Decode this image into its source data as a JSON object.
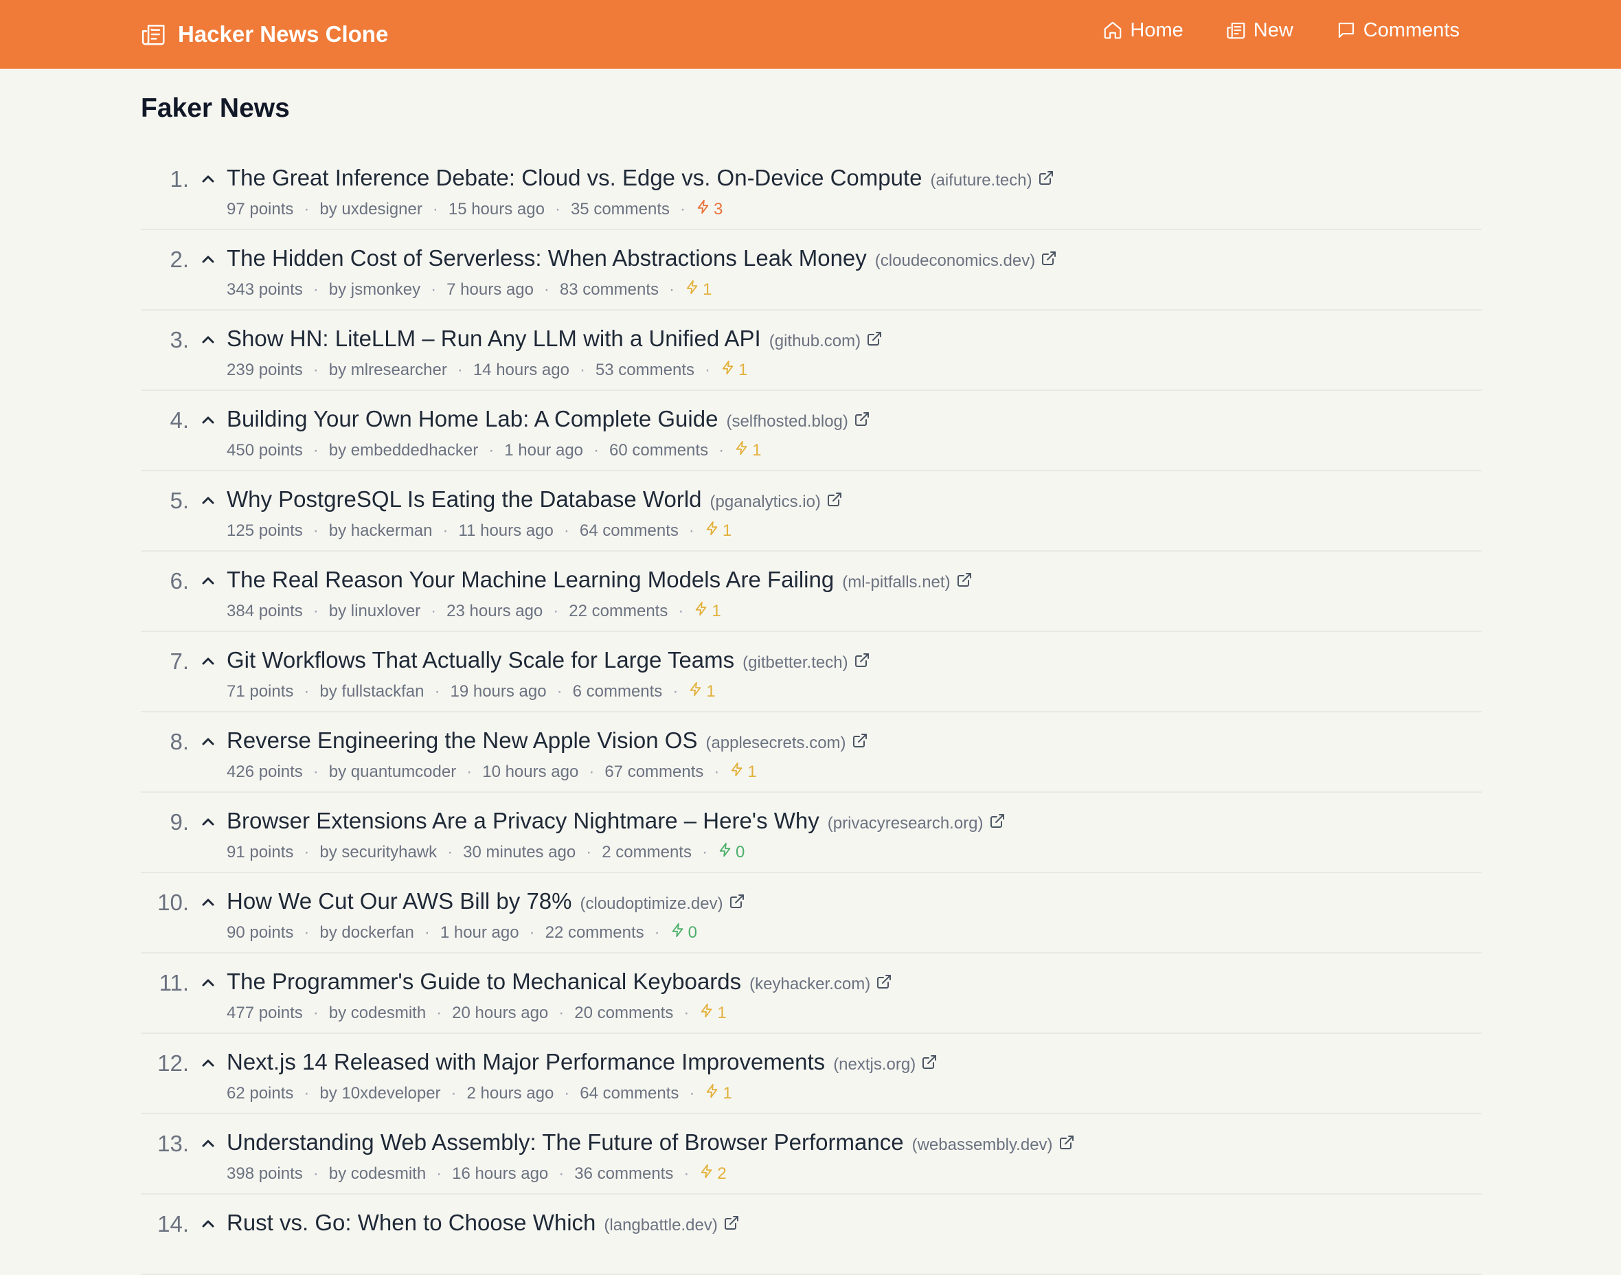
{
  "header": {
    "app_name": "Hacker News Clone",
    "nav": [
      {
        "label": "Home",
        "icon": "home-icon"
      },
      {
        "label": "New",
        "icon": "newspaper-icon"
      },
      {
        "label": "Comments",
        "icon": "comment-icon"
      }
    ],
    "logo_icon": "newspaper-icon",
    "accent_color": "#f07b38"
  },
  "main": {
    "title": "Faker News",
    "stories": [
      {
        "rank": "1.",
        "title": "The Great Inference Debate: Cloud vs. Edge vs. On-Device Compute",
        "domain": "(aifuture.tech)",
        "points": "97 points",
        "author": "by uxdesigner",
        "time": "15 hours ago",
        "comments": "35 comments",
        "boost": "3",
        "boost_color": "#e8743b"
      },
      {
        "rank": "2.",
        "title": "The Hidden Cost of Serverless: When Abstractions Leak Money",
        "domain": "(cloudeconomics.dev)",
        "points": "343 points",
        "author": "by jsmonkey",
        "time": "7 hours ago",
        "comments": "83 comments",
        "boost": "1",
        "boost_color": "#e2b13c"
      },
      {
        "rank": "3.",
        "title": "Show HN: LiteLLM – Run Any LLM with a Unified API",
        "domain": "(github.com)",
        "points": "239 points",
        "author": "by mlresearcher",
        "time": "14 hours ago",
        "comments": "53 comments",
        "boost": "1",
        "boost_color": "#e2b13c"
      },
      {
        "rank": "4.",
        "title": "Building Your Own Home Lab: A Complete Guide",
        "domain": "(selfhosted.blog)",
        "points": "450 points",
        "author": "by embeddedhacker",
        "time": "1 hour ago",
        "comments": "60 comments",
        "boost": "1",
        "boost_color": "#e2b13c"
      },
      {
        "rank": "5.",
        "title": "Why PostgreSQL Is Eating the Database World",
        "domain": "(pganalytics.io)",
        "points": "125 points",
        "author": "by hackerman",
        "time": "11 hours ago",
        "comments": "64 comments",
        "boost": "1",
        "boost_color": "#e2b13c"
      },
      {
        "rank": "6.",
        "title": "The Real Reason Your Machine Learning Models Are Failing",
        "domain": "(ml-pitfalls.net)",
        "points": "384 points",
        "author": "by linuxlover",
        "time": "23 hours ago",
        "comments": "22 comments",
        "boost": "1",
        "boost_color": "#e2b13c"
      },
      {
        "rank": "7.",
        "title": "Git Workflows That Actually Scale for Large Teams",
        "domain": "(gitbetter.tech)",
        "points": "71 points",
        "author": "by fullstackfan",
        "time": "19 hours ago",
        "comments": "6 comments",
        "boost": "1",
        "boost_color": "#e2b13c"
      },
      {
        "rank": "8.",
        "title": "Reverse Engineering the New Apple Vision OS",
        "domain": "(applesecrets.com)",
        "points": "426 points",
        "author": "by quantumcoder",
        "time": "10 hours ago",
        "comments": "67 comments",
        "boost": "1",
        "boost_color": "#e2b13c"
      },
      {
        "rank": "9.",
        "title": "Browser Extensions Are a Privacy Nightmare – Here's Why",
        "domain": "(privacyresearch.org)",
        "points": "91 points",
        "author": "by securityhawk",
        "time": "30 minutes ago",
        "comments": "2 comments",
        "boost": "0",
        "boost_color": "#4caf6a"
      },
      {
        "rank": "10.",
        "title": "How We Cut Our AWS Bill by 78%",
        "domain": "(cloudoptimize.dev)",
        "points": "90 points",
        "author": "by dockerfan",
        "time": "1 hour ago",
        "comments": "22 comments",
        "boost": "0",
        "boost_color": "#4caf6a"
      },
      {
        "rank": "11.",
        "title": "The Programmer's Guide to Mechanical Keyboards",
        "domain": "(keyhacker.com)",
        "points": "477 points",
        "author": "by codesmith",
        "time": "20 hours ago",
        "comments": "20 comments",
        "boost": "1",
        "boost_color": "#e2b13c"
      },
      {
        "rank": "12.",
        "title": "Next.js 14 Released with Major Performance Improvements",
        "domain": "(nextjs.org)",
        "points": "62 points",
        "author": "by 10xdeveloper",
        "time": "2 hours ago",
        "comments": "64 comments",
        "boost": "1",
        "boost_color": "#e2b13c"
      },
      {
        "rank": "13.",
        "title": "Understanding Web Assembly: The Future of Browser Performance",
        "domain": "(webassembly.dev)",
        "points": "398 points",
        "author": "by codesmith",
        "time": "16 hours ago",
        "comments": "36 comments",
        "boost": "2",
        "boost_color": "#e2b13c"
      },
      {
        "rank": "14.",
        "title": "Rust vs. Go: When to Choose Which",
        "domain": "(langbattle.dev)",
        "points": "",
        "author": "",
        "time": "",
        "comments": "",
        "boost": "",
        "boost_color": "#e2b13c"
      }
    ]
  }
}
